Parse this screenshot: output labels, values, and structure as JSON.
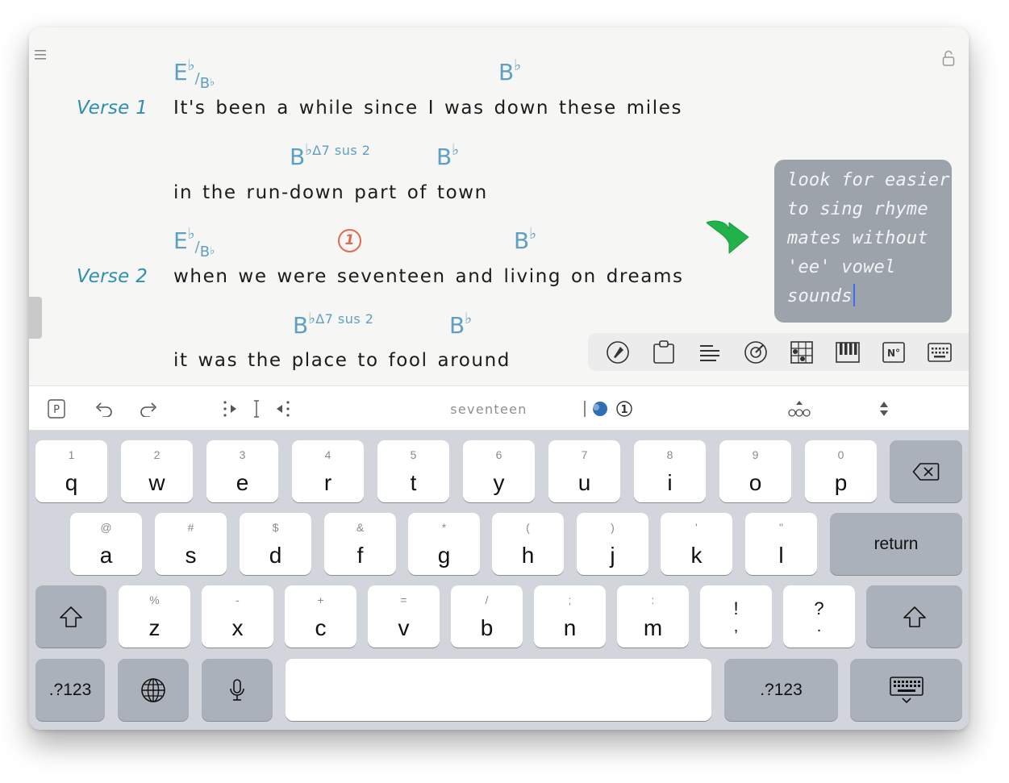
{
  "sheet": {
    "sections": [
      "Verse 1",
      "Verse 2"
    ],
    "lyrics": [
      "It's been a while since I was down these miles",
      "in the run-down part of town",
      "when we were seventeen and living on dreams",
      "it was the place to fool around"
    ],
    "chords": {
      "eb_root": "E",
      "flat": "♭",
      "slash": "/",
      "bass_b": "B",
      "b_root": "B",
      "ext_maj7sus2": "Δ7 sus 2"
    },
    "marker_number": "1",
    "note": {
      "lines": [
        "look for easier",
        "to sing rhyme",
        "mates without",
        "'ee' vowel",
        "sounds"
      ]
    },
    "colors": {
      "chord": "#5f9fc1",
      "section": "#2f8fb0",
      "marker": "#e3674f",
      "arrow": "#22b24c",
      "note_bg": "#9da3aa"
    },
    "icons": [
      "menu-icon",
      "lock-icon",
      "pen-icon",
      "clipboard-icon",
      "align-icon",
      "metronome-icon",
      "chord-grid-icon",
      "piano-icon",
      "number-icon",
      "keyboard-icon"
    ]
  },
  "toolbar": {
    "p_label": "P",
    "selected_word": "seventeen",
    "marker_number": "1"
  },
  "keyboard": {
    "row1": [
      {
        "hint": "1",
        "key": "q"
      },
      {
        "hint": "2",
        "key": "w"
      },
      {
        "hint": "3",
        "key": "e"
      },
      {
        "hint": "4",
        "key": "r"
      },
      {
        "hint": "5",
        "key": "t"
      },
      {
        "hint": "6",
        "key": "y"
      },
      {
        "hint": "7",
        "key": "u"
      },
      {
        "hint": "8",
        "key": "i"
      },
      {
        "hint": "9",
        "key": "o"
      },
      {
        "hint": "0",
        "key": "p"
      }
    ],
    "row2": [
      {
        "hint": "@",
        "key": "a"
      },
      {
        "hint": "#",
        "key": "s"
      },
      {
        "hint": "$",
        "key": "d"
      },
      {
        "hint": "&",
        "key": "f"
      },
      {
        "hint": "*",
        "key": "g"
      },
      {
        "hint": "(",
        "key": "h"
      },
      {
        "hint": ")",
        "key": "j"
      },
      {
        "hint": "'",
        "key": "k"
      },
      {
        "hint": "\"",
        "key": "l"
      }
    ],
    "row3": [
      {
        "hint": "%",
        "key": "z"
      },
      {
        "hint": "-",
        "key": "x"
      },
      {
        "hint": "+",
        "key": "c"
      },
      {
        "hint": "=",
        "key": "v"
      },
      {
        "hint": "/",
        "key": "b"
      },
      {
        "hint": ";",
        "key": "n"
      },
      {
        "hint": ":",
        "key": "m"
      }
    ],
    "punct": [
      {
        "top": "!",
        "bottom": ","
      },
      {
        "top": "?",
        "bottom": "."
      }
    ],
    "return_label": "return",
    "numbers_label": ".?123"
  }
}
